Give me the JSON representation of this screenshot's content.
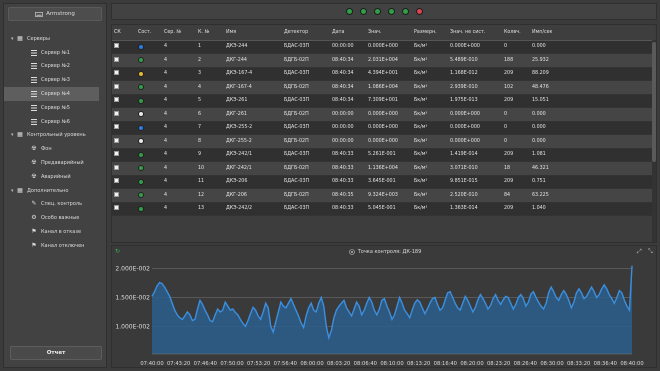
{
  "brand": {
    "label": "Armstrong"
  },
  "sidebar": {
    "groups": [
      {
        "label": "Серверы",
        "items": [
          {
            "label": "Сервер №1",
            "selected": false
          },
          {
            "label": "Сервер №2",
            "selected": false
          },
          {
            "label": "Сервер №3",
            "selected": false
          },
          {
            "label": "Сервер №4",
            "selected": true
          },
          {
            "label": "Сервер №5",
            "selected": false
          },
          {
            "label": "Сервер №6",
            "selected": false
          }
        ]
      },
      {
        "label": "Контрольный уровень",
        "items": [
          {
            "label": "Фон",
            "icon": "radiation-icon"
          },
          {
            "label": "Предаварийный",
            "icon": "radiation-icon"
          },
          {
            "label": "Аварийный",
            "icon": "radiation-icon"
          }
        ]
      },
      {
        "label": "Дополнительно",
        "items": [
          {
            "label": "Спец. контроль",
            "icon": "tag-icon"
          },
          {
            "label": "Особо важные",
            "icon": "gear-icon"
          },
          {
            "label": "Канал в отказе",
            "icon": "flag-icon"
          },
          {
            "label": "Канал отключен",
            "icon": "flag-icon"
          }
        ]
      }
    ],
    "report_label": "Отчет"
  },
  "status_leds": [
    "#2f9e46",
    "#2f9e46",
    "#2f9e46",
    "#2f9e46",
    "#2f9e46",
    "#d9444d"
  ],
  "table": {
    "headers": [
      "СК",
      "Сост.",
      "Сер. №",
      "К. №",
      "Имя",
      "Детектор",
      "Дата",
      "Знач.",
      "Размерн.",
      "Знач. не сист.",
      "Колвч.",
      "Имп/сек"
    ],
    "rows": [
      {
        "state": "#2a7de1",
        "ser": "4",
        "k": "1",
        "name": "ДКЭ-244",
        "det": "БДАС-03П",
        "date": "00:00:00",
        "val": "0.000E+000",
        "unit": "Бк/м³",
        "nsys": "0.000E+000",
        "cnt": "0",
        "ips": "0.000"
      },
      {
        "state": "#2f9e46",
        "ser": "4",
        "k": "2",
        "name": "ДКГ-244",
        "det": "БДГБ-02П",
        "date": "08:40:34",
        "val": "2.031E+004",
        "unit": "Бк/м³",
        "nsys": "5.489E-010",
        "cnt": "188",
        "ips": "25.932"
      },
      {
        "state": "#e6b830",
        "ser": "4",
        "k": "3",
        "name": "ДКЭ-167-4",
        "det": "БДАС-03П",
        "date": "08:40:34",
        "val": "4.394E+001",
        "unit": "Бк/м³",
        "nsys": "1.168E-012",
        "cnt": "209",
        "ips": "88.209"
      },
      {
        "state": "#2f9e46",
        "ser": "4",
        "k": "4",
        "name": "ДКГ-167-4",
        "det": "БДГБ-02П",
        "date": "08:40:34",
        "val": "1.086E+004",
        "unit": "Бк/м³",
        "nsys": "2.939E-010",
        "cnt": "102",
        "ips": "48.476"
      },
      {
        "state": "#2f9e46",
        "ser": "4",
        "k": "5",
        "name": "ДКЭ-261",
        "det": "БДАС-03П",
        "date": "08:40:34",
        "val": "7.309E+001",
        "unit": "Бк/м³",
        "nsys": "1.975E-013",
        "cnt": "209",
        "ips": "15.051"
      },
      {
        "state": "#e8e8e8",
        "ser": "4",
        "k": "6",
        "name": "ДКГ-261",
        "det": "БДГБ-02П",
        "date": "00:00:00",
        "val": "0.000E+000",
        "unit": "Бк/м³",
        "nsys": "0.000E+000",
        "cnt": "0",
        "ips": "0.000"
      },
      {
        "state": "#2a7de1",
        "ser": "4",
        "k": "7",
        "name": "ДКЭ-255-2",
        "det": "БДАС-03П",
        "date": "00:00:00",
        "val": "0.000E+000",
        "unit": "Бк/м³",
        "nsys": "0.000E+000",
        "cnt": "0",
        "ips": "0.000"
      },
      {
        "state": "#e8e8e8",
        "ser": "4",
        "k": "8",
        "name": "ДКГ-255-2",
        "det": "БДГБ-02П",
        "date": "00:00:00",
        "val": "0.000E+000",
        "unit": "Бк/м³",
        "nsys": "0.000E+000",
        "cnt": "0",
        "ips": "0.000"
      },
      {
        "state": "#2f9e46",
        "ser": "4",
        "k": "9",
        "name": "ДКЭ-242/1",
        "det": "БДАС-03П",
        "date": "08:40:33",
        "val": "5.261E-001",
        "unit": "Бк/м³",
        "nsys": "1.419E-014",
        "cnt": "209",
        "ips": "1.081"
      },
      {
        "state": "#2f9e46",
        "ser": "4",
        "k": "10",
        "name": "ДКГ-242/1",
        "det": "БДГБ-02П",
        "date": "08:40:33",
        "val": "1.136E+004",
        "unit": "Бк/м³",
        "nsys": "3.071E-010",
        "cnt": "18",
        "ips": "46.321"
      },
      {
        "state": "#2f9e46",
        "ser": "4",
        "k": "11",
        "name": "ДКЭ-206",
        "det": "БДАС-03П",
        "date": "08:40:33",
        "val": "3.645E-001",
        "unit": "Бк/м³",
        "nsys": "9.851E-015",
        "cnt": "209",
        "ips": "0.751"
      },
      {
        "state": "#2f9e46",
        "ser": "4",
        "k": "12",
        "name": "ДКГ-206",
        "det": "БДГБ-02П",
        "date": "08:40:35",
        "val": "9.324E+003",
        "unit": "Бк/м³",
        "nsys": "2.520E-010",
        "cnt": "84",
        "ips": "63.225"
      },
      {
        "state": "#2f9e46",
        "ser": "4",
        "k": "13",
        "name": "ДКЭ-242/2",
        "det": "БДАС-03П",
        "date": "08:40:33",
        "val": "5.045E-001",
        "unit": "Бк/м³",
        "nsys": "1.363E-014",
        "cnt": "209",
        "ips": "1.040"
      }
    ]
  },
  "chart_panel": {
    "title": "Точка контроля: ДК-189"
  },
  "chart_data": {
    "type": "area",
    "title": "Точка контроля: ДК-189",
    "ytick_labels": [
      "1.000E-002",
      "1.500E-002",
      "2.000E-002"
    ],
    "ytick_values": [
      0.01,
      0.015,
      0.02
    ],
    "ylim": [
      0.0052,
      0.0215
    ],
    "xtick_labels": [
      "07:40:00",
      "07:43:20",
      "07:46:40",
      "07:50:00",
      "07:53:20",
      "07:56:40",
      "08:00:00",
      "08:03:20",
      "08:06:40",
      "08:10:00",
      "08:13:20",
      "08:16:40",
      "08:20:00",
      "08:23:20",
      "08:26:40",
      "08:30:00",
      "08:33:20",
      "08:36:40",
      "08:40:00"
    ],
    "xlim_minutes": [
      0,
      60
    ],
    "values": [
      0.0152,
      0.016,
      0.017,
      0.0176,
      0.0174,
      0.0168,
      0.016,
      0.0152,
      0.014,
      0.0128,
      0.012,
      0.0115,
      0.0112,
      0.0118,
      0.0125,
      0.012,
      0.011,
      0.0112,
      0.013,
      0.0145,
      0.0138,
      0.0128,
      0.012,
      0.011,
      0.0108,
      0.012,
      0.013,
      0.0125,
      0.0128,
      0.0142,
      0.0135,
      0.0128,
      0.013,
      0.0124,
      0.012,
      0.0112,
      0.0105,
      0.01,
      0.011,
      0.0122,
      0.0133,
      0.0128,
      0.0118,
      0.0112,
      0.0125,
      0.014,
      0.0132,
      0.01,
      0.009,
      0.0108,
      0.0125,
      0.0142,
      0.0135,
      0.0132,
      0.014,
      0.0148,
      0.0138,
      0.0128,
      0.0118,
      0.0106,
      0.0098,
      0.0118,
      0.0132,
      0.014,
      0.0128,
      0.0125,
      0.014,
      0.015,
      0.0135,
      0.01,
      0.008,
      0.0093,
      0.0115,
      0.0128,
      0.0135,
      0.014,
      0.0145,
      0.0132,
      0.0125,
      0.0118,
      0.013,
      0.0142,
      0.0135,
      0.012,
      0.0128,
      0.014,
      0.015,
      0.0142,
      0.0128,
      0.012,
      0.013,
      0.0145,
      0.0148,
      0.0135,
      0.0125,
      0.0112,
      0.012,
      0.0135,
      0.015,
      0.014,
      0.0128,
      0.0122,
      0.0115,
      0.0128,
      0.014,
      0.0146,
      0.0142,
      0.0132,
      0.0122,
      0.013,
      0.014,
      0.0148,
      0.015,
      0.0138,
      0.0128,
      0.0132,
      0.0145,
      0.0158,
      0.016,
      0.015,
      0.014,
      0.0132,
      0.0128,
      0.014,
      0.0152,
      0.0145,
      0.0135,
      0.0125,
      0.0133,
      0.0146,
      0.0155,
      0.0148,
      0.014,
      0.013,
      0.0136,
      0.0148,
      0.0155,
      0.0145,
      0.0138,
      0.0146,
      0.0152,
      0.015,
      0.014,
      0.013,
      0.0138,
      0.015,
      0.0155,
      0.0148,
      0.0135,
      0.0142,
      0.0156,
      0.016,
      0.015,
      0.0142,
      0.0135,
      0.013,
      0.014,
      0.0158,
      0.0168,
      0.016,
      0.015,
      0.0145,
      0.0155,
      0.0162,
      0.0155,
      0.0145,
      0.0132,
      0.0142,
      0.0158,
      0.0165,
      0.0158,
      0.0148,
      0.0152,
      0.016,
      0.0168,
      0.016,
      0.015,
      0.0155,
      0.0165,
      0.0172,
      0.0165,
      0.0155,
      0.0148,
      0.014,
      0.015,
      0.0162,
      0.0158,
      0.0145,
      0.0135,
      0.0128,
      0.0205
    ],
    "grid": true,
    "color": "#3a8fe0"
  }
}
